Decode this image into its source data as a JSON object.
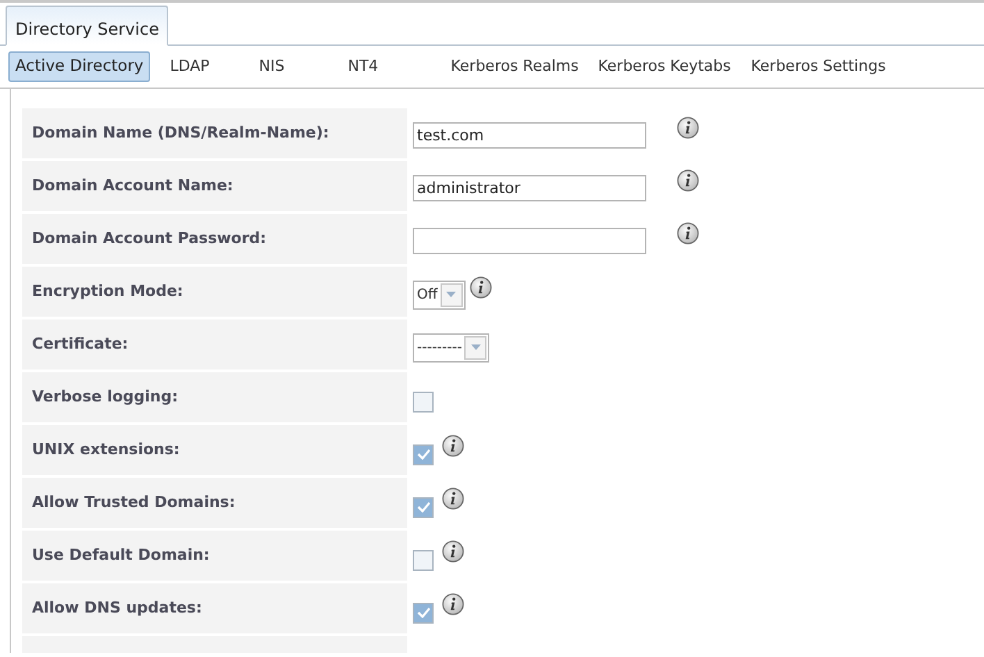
{
  "top_tabs": [
    {
      "label": "Directory Service",
      "selected": true
    }
  ],
  "sub_tabs": [
    {
      "label": "Active Directory",
      "selected": true
    },
    {
      "label": "LDAP",
      "selected": false
    },
    {
      "label": "NIS",
      "selected": false
    },
    {
      "label": "NT4",
      "selected": false
    },
    {
      "label": "Kerberos Realms",
      "selected": false
    },
    {
      "label": "Kerberos Keytabs",
      "selected": false
    },
    {
      "label": "Kerberos Settings",
      "selected": false
    }
  ],
  "form": [
    {
      "label": "Domain Name (DNS/Realm-Name):",
      "kind": "text",
      "value": "test.com",
      "info": true
    },
    {
      "label": "Domain Account Name:",
      "kind": "text",
      "value": "administrator",
      "info": true
    },
    {
      "label": "Domain Account Password:",
      "kind": "password",
      "info": true
    },
    {
      "label": "Encryption Mode:",
      "kind": "select",
      "value": "Off",
      "info": true
    },
    {
      "label": "Certificate:",
      "kind": "select",
      "value": "---------",
      "info": false
    },
    {
      "label": "Verbose logging:",
      "kind": "checkbox",
      "checked": false,
      "info": false
    },
    {
      "label": "UNIX extensions:",
      "kind": "checkbox",
      "checked": true,
      "info": true
    },
    {
      "label": "Allow Trusted Domains:",
      "kind": "checkbox",
      "checked": true,
      "info": true
    },
    {
      "label": "Use Default Domain:",
      "kind": "checkbox",
      "checked": false,
      "info": true
    },
    {
      "label": "Allow DNS updates:",
      "kind": "checkbox",
      "checked": true,
      "info": true
    }
  ]
}
